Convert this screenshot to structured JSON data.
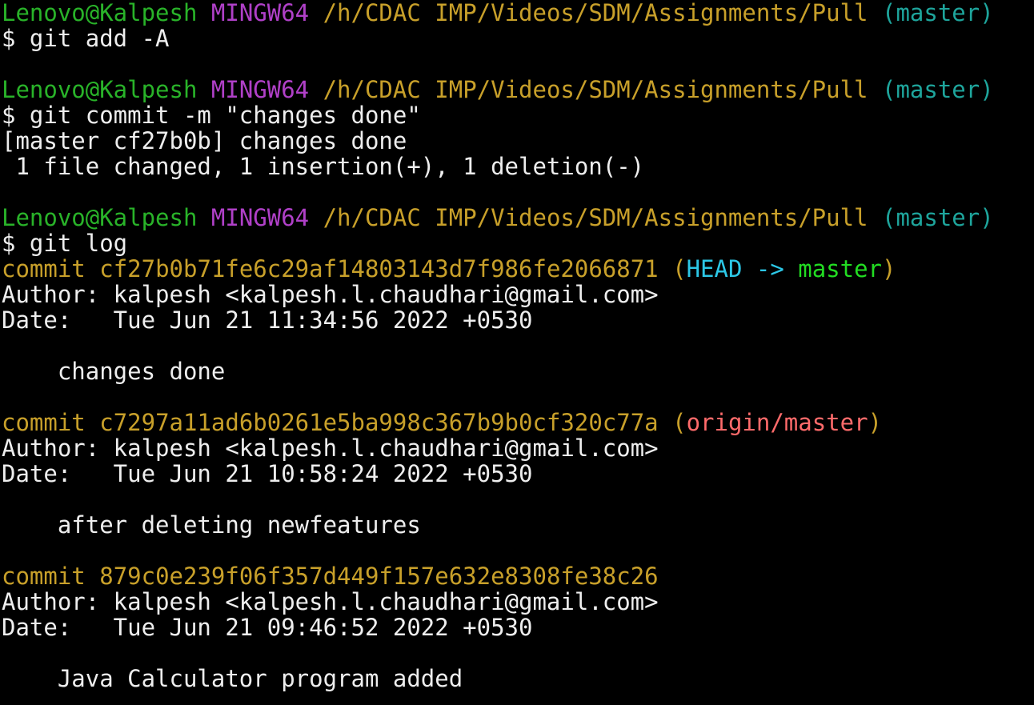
{
  "prompt": {
    "user_host": "Lenovo@Kalpesh",
    "system": "MINGW64",
    "path": "/h/CDAC IMP/Videos/SDM/Assignments/Pull",
    "branch": "(master)"
  },
  "commands": {
    "add": "$ git add -A",
    "commit": "$ git commit -m \"changes done\"",
    "log": "$ git log"
  },
  "commit_output": {
    "summary": "[master cf27b0b] changes done",
    "stats": " 1 file changed, 1 insertion(+), 1 deletion(-)"
  },
  "log": {
    "commit_keyword": "commit",
    "entries": [
      {
        "hash": "cf27b0b71fe6c29af14803143d7f986fe2066871",
        "ref_open": "(",
        "ref_head": "HEAD ->",
        "ref_branch": "master",
        "ref_close": ")",
        "author": "Author: kalpesh <kalpesh.l.chaudhari@gmail.com>",
        "date": "Date:   Tue Jun 21 11:34:56 2022 +0530",
        "message": "    changes done"
      },
      {
        "hash": "c7297a11ad6b0261e5ba998c367b9b0cf320c77a",
        "ref_open": "(",
        "ref_remote": "origin/master",
        "ref_close": ")",
        "author": "Author: kalpesh <kalpesh.l.chaudhari@gmail.com>",
        "date": "Date:   Tue Jun 21 10:58:24 2022 +0530",
        "message": "    after deleting newfeatures"
      },
      {
        "hash": "879c0e239f06f357d449f157e632e8308fe38c26",
        "author": "Author: kalpesh <kalpesh.l.chaudhari@gmail.com>",
        "date": "Date:   Tue Jun 21 09:46:52 2022 +0530",
        "message": "    Java Calculator program added"
      }
    ]
  },
  "colors": {
    "background": "#000000",
    "user_host": "#29b329",
    "system": "#b040c8",
    "path": "#c8a02a",
    "branch": "#1ea59c",
    "commit_hash": "#c8a02a",
    "head_ref": "#2cc7e6",
    "local_branch_ref": "#22dd22",
    "remote_ref": "#ff6b6b",
    "text": "#eeeeee"
  }
}
